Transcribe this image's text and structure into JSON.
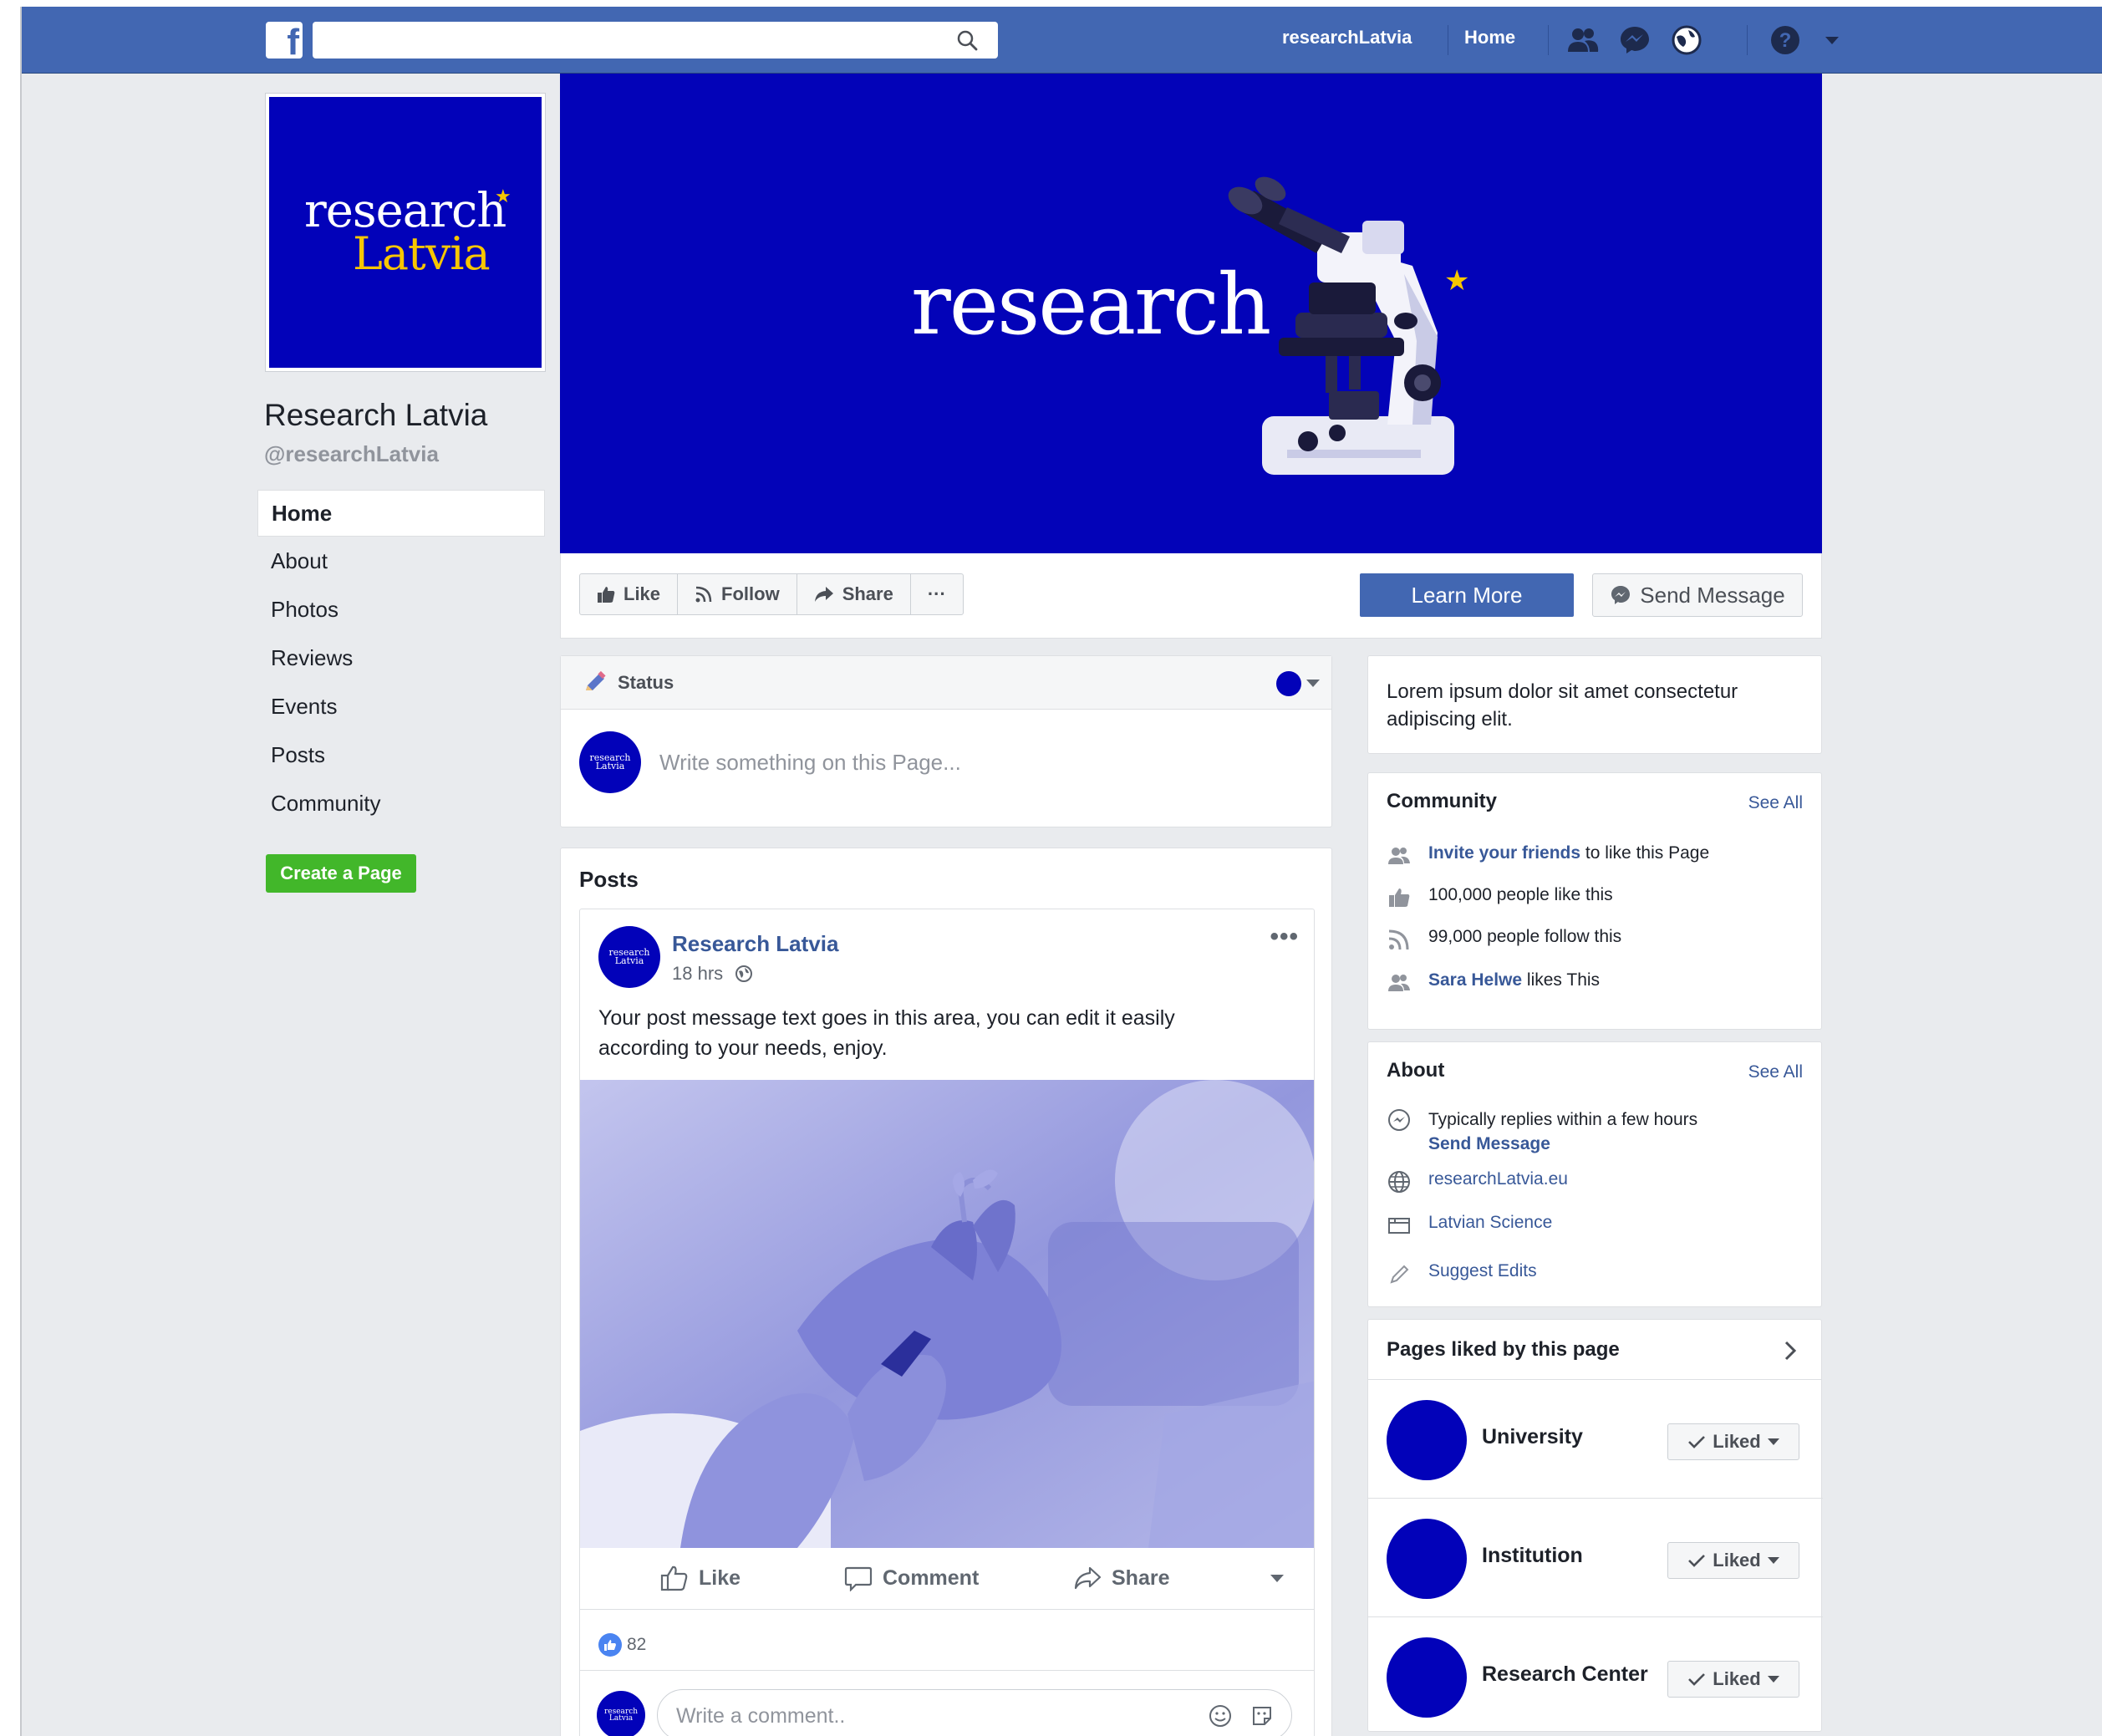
{
  "topbar": {
    "logo": "f",
    "search_placeholder": "",
    "profile_link": "researchLatvia",
    "home_link": "Home",
    "icons": [
      "friends-icon",
      "messenger-icon",
      "notifications-globe-icon",
      "help-icon",
      "caret-down-icon"
    ]
  },
  "profile": {
    "logo_word1": "research",
    "logo_word2": "Latvia",
    "logo_star": "★",
    "name": "Research Latvia",
    "handle": "@researchLatvia"
  },
  "nav": {
    "items": [
      "Home",
      "About",
      "Photos",
      "Reviews",
      "Events",
      "Posts",
      "Community"
    ],
    "active": "Home",
    "create_page": "Create a Page"
  },
  "cover": {
    "title": "research",
    "star": "★"
  },
  "actions": {
    "like": "Like",
    "follow": "Follow",
    "share": "Share",
    "more": "···",
    "learn_more": "Learn More",
    "send_message": "Send Message"
  },
  "composer": {
    "tab": "Status",
    "placeholder": "Write something on this Page...",
    "avatar_text1": "research",
    "avatar_text2": "Latvia"
  },
  "posts": {
    "heading": "Posts",
    "post": {
      "author": "Research Latvia",
      "time": "18 hrs",
      "more": "•••",
      "text": "Your post message text goes in this area, you can edit it easily according to your needs, enjoy.",
      "like_label": "Like",
      "comment_label": "Comment",
      "share_label": "Share",
      "reaction_count": "82",
      "comment_placeholder": "Write a comment.."
    }
  },
  "sidebar": {
    "intro": "Lorem ipsum dolor sit amet consectetur adipiscing elit.",
    "community": {
      "title": "Community",
      "see_all": "See All",
      "invite_link": "Invite your friends",
      "invite_rest": " to like this Page",
      "likes": "100,000 people like this",
      "follows": "99,000 people follow this",
      "friend_name": "Sara Helwe",
      "friend_rest": " likes This"
    },
    "about": {
      "title": "About",
      "see_all": "See All",
      "replies": "Typically replies within a few hours",
      "send_message": "Send Message",
      "website": "researchLatvia.eu",
      "category": "Latvian Science",
      "suggest": "Suggest Edits"
    },
    "liked_pages": {
      "title": "Pages liked by this page",
      "items": [
        {
          "name": "University",
          "button": "Liked"
        },
        {
          "name": "Institution",
          "button": "Liked"
        },
        {
          "name": "Research Center",
          "button": "Liked"
        }
      ]
    }
  },
  "colors": {
    "brand_blue": "#4267b2",
    "page_blue": "#0202b9",
    "accent_yellow": "#f7c600",
    "create_green": "#42b72a",
    "link": "#385898"
  }
}
